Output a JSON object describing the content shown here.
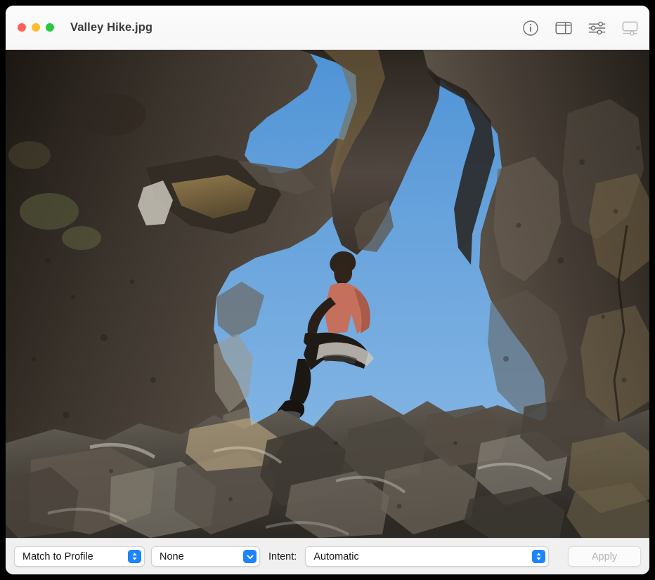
{
  "window": {
    "title": "Valley Hike.jpg",
    "traffic_lights": [
      {
        "name": "close",
        "color": "#ff5f57"
      },
      {
        "name": "minimize",
        "color": "#febc2e"
      },
      {
        "name": "zoom",
        "color": "#28c840"
      }
    ]
  },
  "toolbar": {
    "icons": [
      {
        "name": "info-icon",
        "label": "Show Info"
      },
      {
        "name": "sidebar-icon",
        "label": "Show Sidebar"
      },
      {
        "name": "adjust-icon",
        "label": "Adjust Color"
      },
      {
        "name": "display-icon",
        "label": "Match Display",
        "disabled": true
      }
    ]
  },
  "image": {
    "alt": "Person in a salmon shirt sitting on dark volcanic rock formations, looking up at a heart-shaped opening of blue sky",
    "sky_color": "#6ea7de",
    "rock_dark": "#2a2622",
    "rock_mid": "#595049",
    "rock_light": "#9a958c",
    "shirt_color": "#c4705c"
  },
  "bottombar": {
    "match_popup": {
      "value": "Match to Profile",
      "type": "up-down"
    },
    "profile_popup": {
      "value": "None",
      "type": "down"
    },
    "intent_label": "Intent:",
    "intent_popup": {
      "value": "Automatic",
      "type": "up-down"
    },
    "apply_button": {
      "label": "Apply",
      "disabled": true
    },
    "accent_color": "#1d84fb"
  }
}
